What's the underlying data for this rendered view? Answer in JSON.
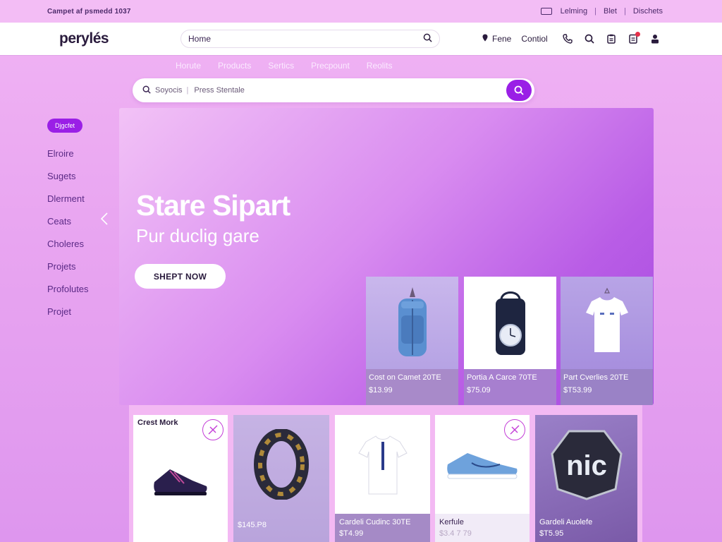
{
  "topbar": {
    "promo": "Cаmpet af psmedd 1037",
    "links": [
      "Lelming",
      "Blet",
      "Dischets"
    ]
  },
  "header": {
    "logo": "perylés",
    "search": {
      "value": "Home"
    },
    "nav": [
      "Fene",
      "Contiol"
    ],
    "icons": [
      "phone-icon",
      "search-icon",
      "clipboard-icon",
      "notes-icon",
      "user-icon"
    ]
  },
  "catnav": [
    "Horute",
    "Products",
    "Sertics",
    "Precpount",
    "Reolits"
  ],
  "bigsearch": {
    "scope": "Soyocis",
    "placeholder": "Press Stentale"
  },
  "sidebar": {
    "badge": "Djgcfet",
    "items": [
      "Elroire",
      "Sugets",
      "Dlerment",
      "Ceats",
      "Choleres",
      "Projets",
      "Profolutes",
      "Projet"
    ]
  },
  "hero": {
    "title": "Stare Sipart",
    "subtitle": "Pur duclig gare",
    "cta": "SHEPT NOW",
    "featured": [
      {
        "name": "Cost on Camet 20TE",
        "price": "$13.99"
      },
      {
        "name": "Portia A Carce 70TE",
        "price": "$75.09"
      },
      {
        "name": "Part Cverlies 20TE",
        "price": "$T53.99"
      }
    ]
  },
  "products": [
    {
      "title": "Crest Mork",
      "name": "",
      "price": ""
    },
    {
      "title": "",
      "name": "",
      "price": "$145.P8"
    },
    {
      "title": "",
      "name": "Cardeli Cudinc 30TE",
      "price": "$T4.99"
    },
    {
      "title": "",
      "name": "Kerfule",
      "price": "$3.4 7 79"
    },
    {
      "title": "",
      "name": "Gardeli Auolefe",
      "price": "$T5.95"
    }
  ],
  "colors": {
    "accent": "#9a1fe6",
    "background": "#e9a6f1"
  }
}
